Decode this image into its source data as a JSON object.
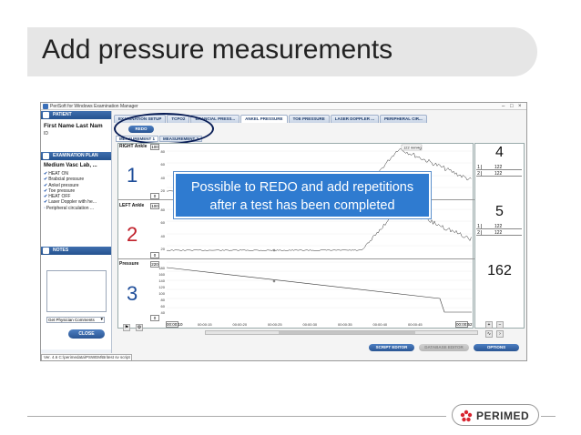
{
  "slide": {
    "title": "Add pressure measurements",
    "callout_line1": "Possible to REDO and add repetitions",
    "callout_line2": "after a test has been completed",
    "logo_text": "PERIMED"
  },
  "app": {
    "window_title": "PeriSoft for Windows Examination Manager",
    "status_bar": "Ver. 4.6   C:\\perimedata\\PSWEM\\Britest sv script"
  },
  "left_panel": {
    "patient_header": "PATIENT",
    "patient_name": "First Name Last Nam",
    "patient_id": "ID",
    "plan_header": "EXAMINATION PLAN",
    "plan_name": "Medium Vasc Lab, ...",
    "plan_items": [
      {
        "label": "HEAT ON",
        "checked": true
      },
      {
        "label": "Brabcial pressure",
        "checked": true
      },
      {
        "label": "Ankel pressure",
        "checked": true
      },
      {
        "label": "Toe pressure",
        "checked": true
      },
      {
        "label": "HEAT OFF",
        "checked": true
      },
      {
        "label": "Laser Doppler with he...",
        "checked": true
      },
      {
        "label": "Peripheral circulation ...",
        "checked": false
      }
    ],
    "notes_header": "NOTES",
    "physician_select": "Get Physician Comments",
    "close_button": "CLOSE"
  },
  "tabs": [
    {
      "label": "EXAMINATION SETUP",
      "active": false
    },
    {
      "label": "TCPO2",
      "active": false
    },
    {
      "label": "BRANCIAL PRESS...",
      "active": false
    },
    {
      "label": "ANKEL PRESSURE",
      "active": true
    },
    {
      "label": "TOE PRESSURE",
      "active": false
    },
    {
      "label": "LASER DOPPLER ...",
      "active": false
    },
    {
      "label": "PERIPHERAL CIR...",
      "active": false
    }
  ],
  "redo_button": "REDO",
  "measurement_tabs": [
    {
      "label": "MEASUREMENT 1",
      "active": true
    },
    {
      "label": "MEASUREMENT 2",
      "active": false
    }
  ],
  "tracks": [
    {
      "label": "RIGHT Ankle",
      "number": "1",
      "number_color": "#1f4e9a",
      "max": "100",
      "min": "0",
      "ticks": [
        "80",
        "60",
        "40",
        "20"
      ],
      "result": "4",
      "rows": [
        {
          "idx": "1",
          "value": "122"
        },
        {
          "idx": "2",
          "value": "122"
        }
      ],
      "marker": "122 mmHg"
    },
    {
      "label": "LEFT Ankle",
      "number": "2",
      "number_color": "#c0202a",
      "max": "100",
      "min": "0",
      "ticks": [
        "80",
        "60",
        "40",
        "20"
      ],
      "result": "5",
      "rows": [
        {
          "idx": "1",
          "value": "122"
        },
        {
          "idx": "2",
          "value": "122"
        }
      ]
    },
    {
      "label": "Pressure",
      "number": "3",
      "number_color": "#1f4e9a",
      "max": "220",
      "min": "0",
      "ticks": [
        "180",
        "160",
        "140",
        "120",
        "100",
        "80",
        "60",
        "40"
      ],
      "result": "162"
    }
  ],
  "time_axis": {
    "start": "00:00:10",
    "end": "00:00:52",
    "labels": [
      "00:00:15",
      "00:00:20",
      "00:00:25",
      "00:00:30",
      "00:00:35",
      "00:00:40",
      "00:00:45"
    ]
  },
  "bottom_buttons": {
    "script_editor": "SCRIPT EDITOR",
    "database_editor": "DATABASE EDITOR",
    "options": "OPTIONS"
  }
}
